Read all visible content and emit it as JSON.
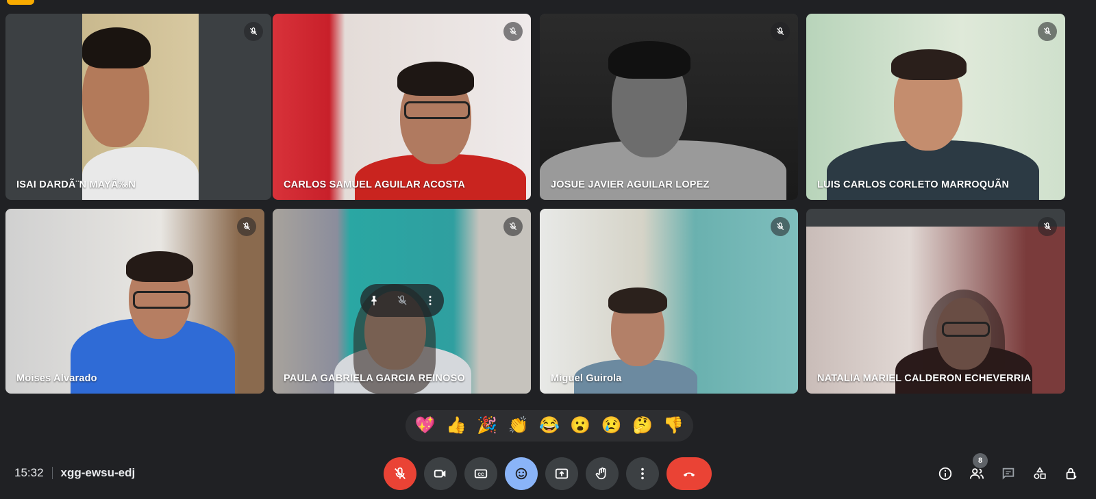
{
  "meeting": {
    "time": "15:32",
    "code": "xgg-ewsu-edj"
  },
  "participants": [
    {
      "name": "ISAI DARDÃ¨N MAYÃ‰N",
      "muted": true
    },
    {
      "name": "CARLOS SAMUEL AGUILAR ACOSTA",
      "muted": true
    },
    {
      "name": "JOSUE JAVIER AGUILAR LOPEZ",
      "muted": true
    },
    {
      "name": "LUIS CARLOS CORLETO MARROQUÃN",
      "muted": true
    },
    {
      "name": "Moises Alvarado",
      "muted": true
    },
    {
      "name": "PAULA GABRIELA GARCIA REINOSO",
      "muted": true
    },
    {
      "name": "Miguel Guirola",
      "muted": true
    },
    {
      "name": "NATALIA MARIEL CALDERON ECHEVERRIA",
      "muted": true
    }
  ],
  "reactions": [
    "💖",
    "👍",
    "🎉",
    "👏",
    "😂",
    "😮",
    "😢",
    "🤔",
    "👎"
  ],
  "controls": [
    "mic-off",
    "camera",
    "captions",
    "emoji",
    "present",
    "raise-hand",
    "more",
    "leave-call"
  ],
  "people_count": "8",
  "colors": {
    "background": "#202124",
    "danger": "#ea4335",
    "active": "#8ab4f8",
    "control": "#3c4043"
  }
}
